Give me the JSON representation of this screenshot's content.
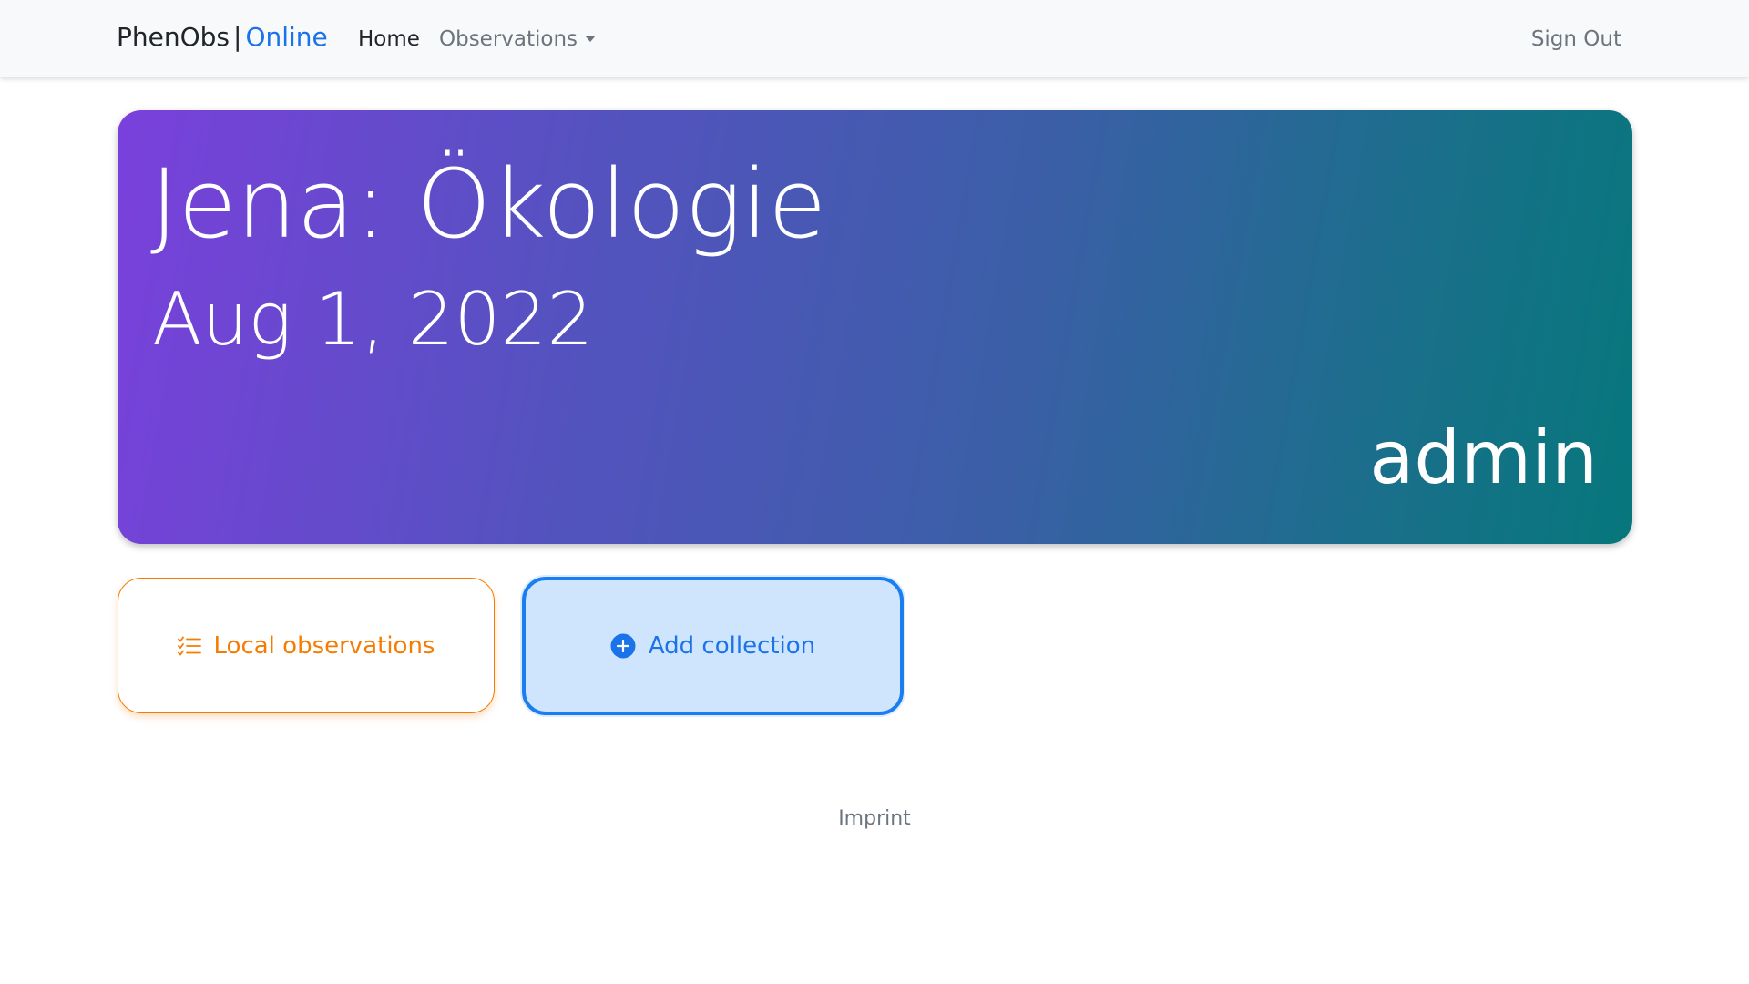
{
  "navbar": {
    "brand_name": "PhenObs",
    "brand_separator": "|",
    "brand_status": "Online",
    "home_label": "Home",
    "observations_label": "Observations",
    "signout_label": "Sign Out"
  },
  "hero": {
    "title": "Jena: Ökologie",
    "date": "Aug 1, 2022",
    "user": "admin"
  },
  "actions": {
    "local_observations_label": "Local observations",
    "add_collection_label": "Add collection"
  },
  "footer": {
    "imprint_label": "Imprint"
  },
  "colors": {
    "accent": "#1a73e8",
    "local_card": "#f57c00",
    "add_card_bg": "#cfe5fd",
    "hero_gradient_start": "#7a40dc",
    "hero_gradient_end": "#06777c"
  },
  "icons": {
    "local_observations": "list-check-icon",
    "add_collection": "plus-circle-icon",
    "observations_dropdown": "caret-down-icon"
  }
}
